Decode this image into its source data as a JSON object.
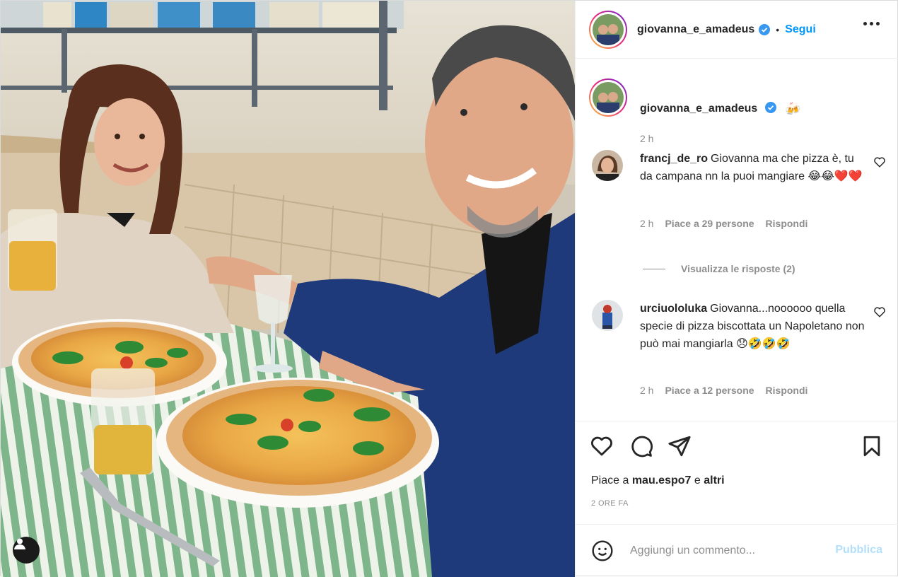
{
  "header": {
    "username": "giovanna_e_amadeus",
    "separator": "•",
    "follow_label": "Segui"
  },
  "caption": {
    "username": "giovanna_e_amadeus",
    "emoji": "🍻",
    "time": "2 h"
  },
  "comments": [
    {
      "username": "francj_de_ro",
      "text": "Giovanna ma che pizza è, tu da campana nn la puoi mangiare 😂😂❤️❤️",
      "time": "2 h",
      "likes": "Piace a 29 persone",
      "reply": "Rispondi",
      "view_replies": "Visualizza le risposte (2)"
    },
    {
      "username": "urciuololuka",
      "text": "Giovanna...noooooo quella specie di pizza biscottata un Napoletano non può mai mangiarla 😞🤣🤣🤣",
      "time": "2 h",
      "likes": "Piace a 12 persone",
      "reply": "Rispondi"
    }
  ],
  "likes": {
    "prefix": "Piace a",
    "user": "mau.espo7",
    "conj": "e",
    "others": "altri"
  },
  "date": "2 ORE FA",
  "add_comment": {
    "placeholder": "Aggiungi un commento...",
    "publish_label": "Pubblica"
  },
  "icons": {
    "like": "heart-icon",
    "comment": "comment-icon",
    "share": "share-icon",
    "save": "bookmark-icon",
    "emoji": "smiley-icon",
    "more": "more-options-icon",
    "tag": "user-tag-icon"
  },
  "colors": {
    "accent": "#0095f6",
    "verified": "#3897f0",
    "muted": "#8e8e8e",
    "heart": "#e0245e"
  }
}
